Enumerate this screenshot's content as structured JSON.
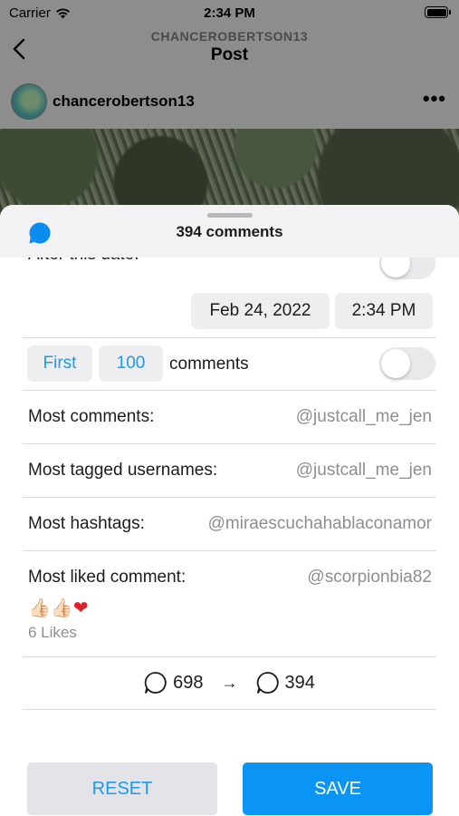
{
  "status_bar": {
    "carrier": "Carrier",
    "time": "2:34 PM"
  },
  "nav": {
    "subtitle": "CHANCEROBERTSON13",
    "title": "Post",
    "back_icon": "chevron-left-icon"
  },
  "author": {
    "username": "chancerobertson13",
    "more_icon": "more-horizontal-icon"
  },
  "sheet": {
    "title": "394 comments",
    "header_icon": "comment-bubble-icon",
    "accent_color": "#1a9af0",
    "after_date": {
      "label": "After this date:",
      "enabled": false,
      "date": "Feb 24, 2022",
      "time": "2:34 PM"
    },
    "first_filter": {
      "first_label": "First",
      "count": "100",
      "suffix": "comments",
      "enabled": false
    },
    "stats": [
      {
        "label": "Most comments:",
        "user": "@justcall_me_jen"
      },
      {
        "label": "Most tagged usernames:",
        "user": "@justcall_me_jen"
      },
      {
        "label": "Most hashtags:",
        "user": "@miraescuchahablaconamor"
      }
    ],
    "most_liked": {
      "label": "Most liked comment:",
      "user": "@scorpionbia82",
      "emoji_text": "👍🏻👍🏻",
      "heart": "❤",
      "likes": "6 Likes"
    },
    "counts": {
      "before": "698",
      "arrow": "→",
      "after": "394"
    },
    "buttons": {
      "reset": "RESET",
      "save": "SAVE"
    }
  }
}
